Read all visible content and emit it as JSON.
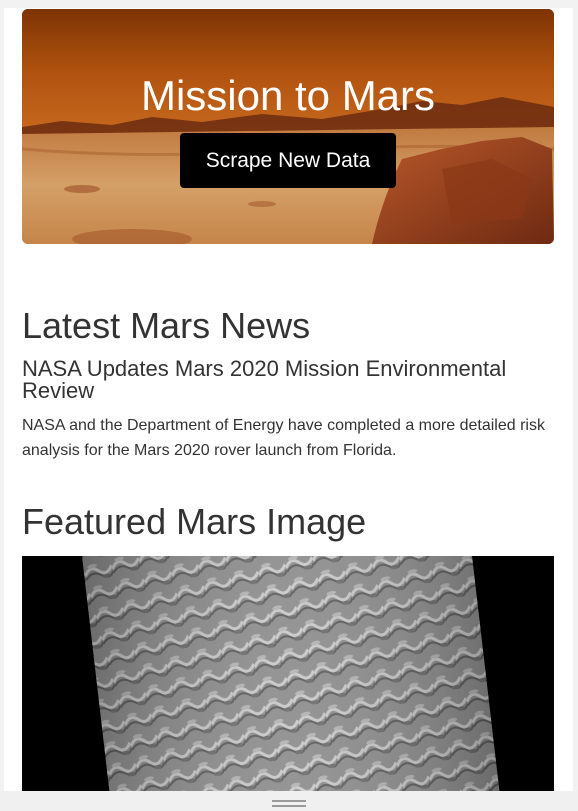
{
  "hero": {
    "title": "Mission to Mars",
    "button_label": "Scrape New Data"
  },
  "news": {
    "heading": "Latest Mars News",
    "title": "NASA Updates Mars 2020 Mission Environmental Review",
    "body": "NASA and the Department of Energy have completed a more detailed risk analysis for the Mars 2020 rover launch from Florida."
  },
  "featured_image": {
    "heading": "Featured Mars Image"
  },
  "colors": {
    "button_bg": "#000000",
    "text": "#333333"
  },
  "icons": {
    "resize_handle": "drag-handle-icon"
  }
}
